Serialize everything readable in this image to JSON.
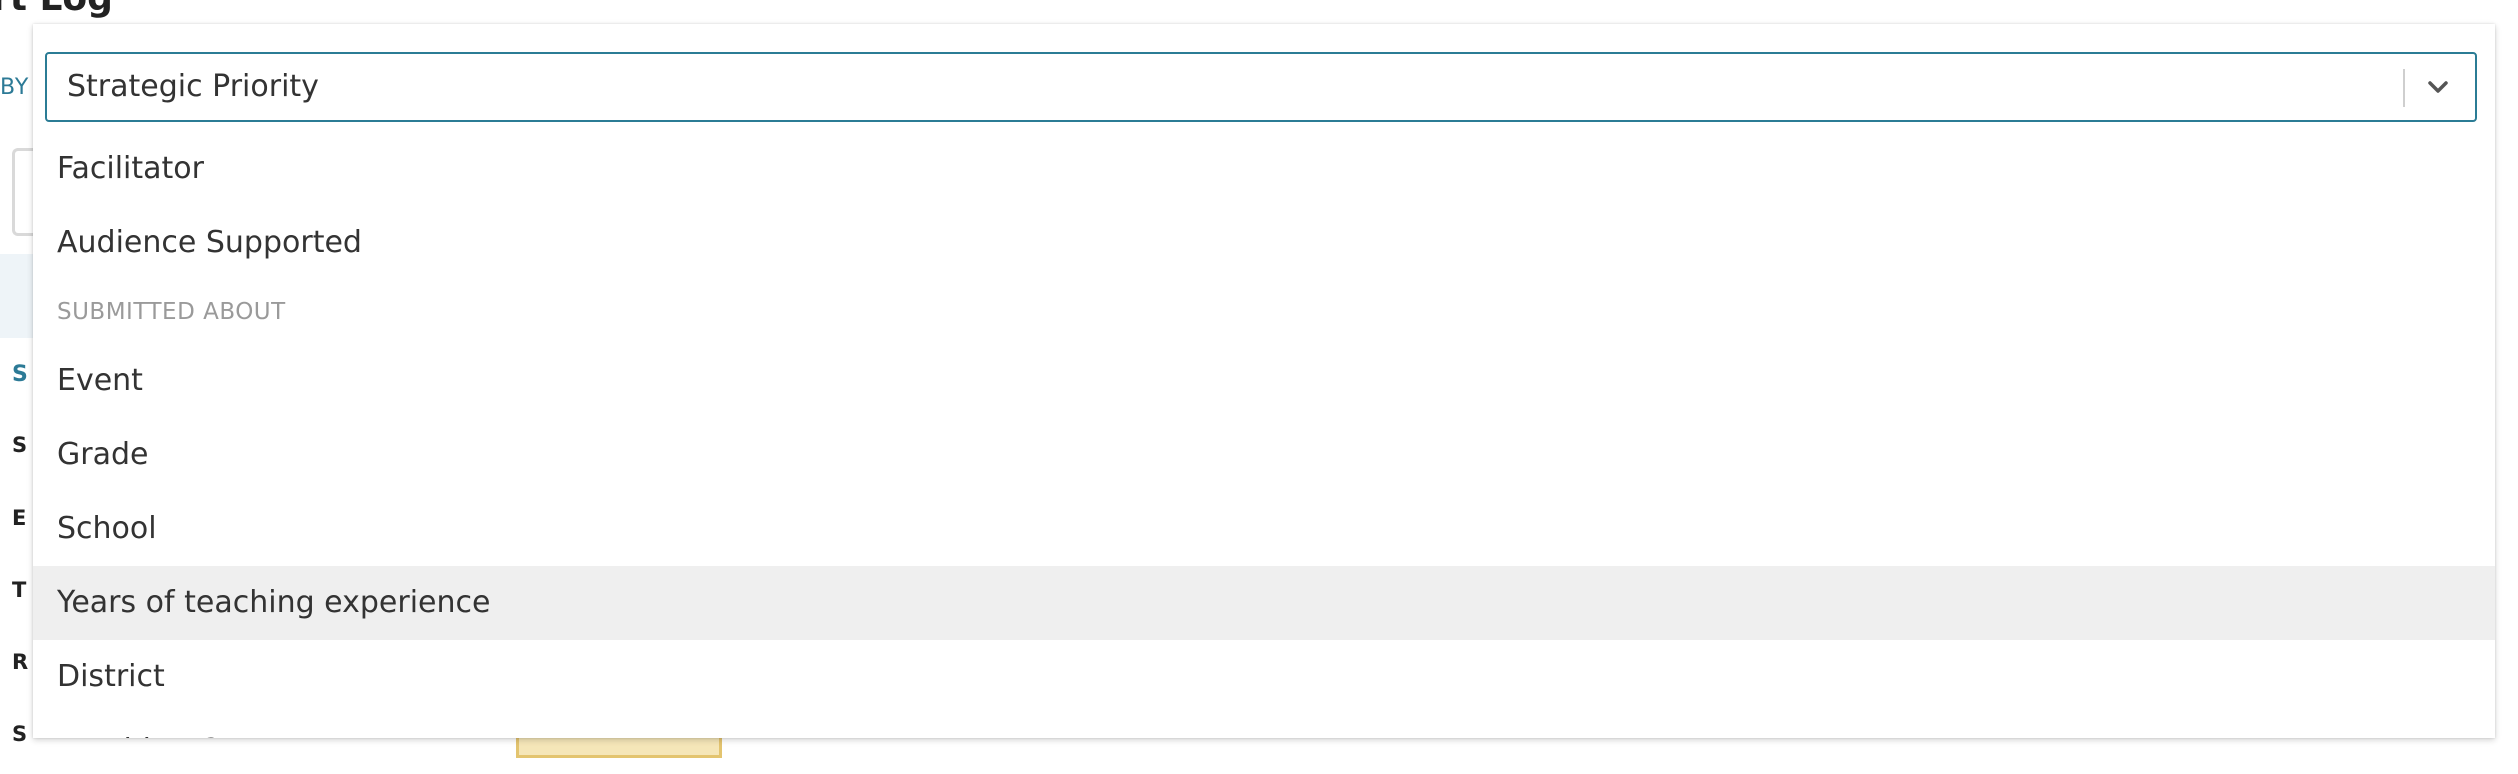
{
  "page": {
    "title_fragment": "rt Log",
    "by_fragment": "BY",
    "side_letters": [
      "S",
      "S",
      "E",
      "T",
      "R",
      "S"
    ]
  },
  "dropdown": {
    "selected_value": "Strategic Priority",
    "options": [
      {
        "label": "Facilitator"
      },
      {
        "label": "Audience Supported"
      }
    ],
    "group_label": "SUBMITTED ABOUT",
    "group_options": [
      {
        "label": "Event"
      },
      {
        "label": "Grade"
      },
      {
        "label": "School"
      },
      {
        "label": "Years of teaching experience",
        "highlighted": true
      },
      {
        "label": "District"
      },
      {
        "label": "Teaching Context"
      }
    ]
  },
  "colors": {
    "focus_border": "#2b7c95",
    "link": "#2c7a96",
    "hover_bg": "#efefef",
    "group_label": "#9a9a9a"
  }
}
